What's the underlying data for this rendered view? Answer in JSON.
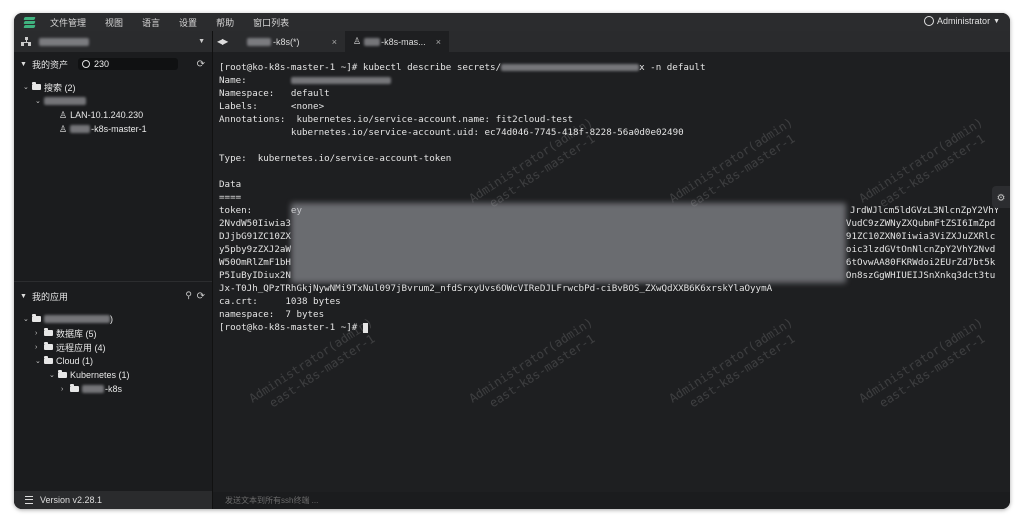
{
  "menu": {
    "items": [
      "文件管理",
      "视图",
      "语言",
      "设置",
      "帮助",
      "窗口列表"
    ],
    "user": "Administrator"
  },
  "sidebar": {
    "assets": {
      "title": "我的资产",
      "search_value": "230",
      "search_group": "搜索 (2)",
      "nodes": [
        "LAN-10.1.240.230",
        "-k8s-master-1"
      ]
    },
    "apps": {
      "title": "我的应用",
      "items": [
        "数据库 (5)",
        "远程应用 (4)",
        "Cloud (1)",
        "Kubernetes (1)",
        "-k8s"
      ]
    },
    "version": "Version v2.28.1"
  },
  "tabs": [
    {
      "label": "-k8s(*)",
      "close": "×"
    },
    {
      "label": "-k8s-mas...",
      "close": "×"
    }
  ],
  "terminal": {
    "lines": [
      {
        "a": "[root@ko-k8s-master-1 ~]# kubectl describe secrets/",
        "b": "x -n default"
      },
      {
        "a": "Name:"
      },
      {
        "a": "Namespace:   default"
      },
      {
        "a": "Labels:      <none>"
      },
      {
        "a": "Annotations:  kubernetes.io/service-account.name: fit2cloud-test"
      },
      {
        "a": "             kubernetes.io/service-account.uid: ec74d046-7745-418f-8228-56a0d0e02490"
      },
      {
        "a": ""
      },
      {
        "a": "Type:  kubernetes.io/service-account-token"
      },
      {
        "a": ""
      },
      {
        "a": "Data"
      },
      {
        "a": "===="
      },
      {
        "a": "token:       ey",
        "b": "JrdWJlcm5ldGVzL3NlcnZpY2VhY"
      },
      {
        "a": "2NvdW50Iiwia3",
        "b": "VudC9zZWNyZXQubmFtZSI6ImZpd"
      },
      {
        "a": "DJjbG91ZC10ZX",
        "b": "91ZC10ZXN0Iiwia3ViZXJuZXRlc"
      },
      {
        "a": "y5pby9zZXJ2aW",
        "b": "oic3lzdGVtOnNlcnZpY2VhY2Nvd"
      },
      {
        "a": "W50OmRlZmF1bH",
        "b": "6tOvwAA80FKRWdoi2EUrZd7bt5k"
      },
      {
        "a": "P5IuByIDiux2N",
        "b": "On8szGgWHIUEIJSnXnkq3dct3tu"
      },
      {
        "a": "Jx-T0Jh_QPzTRhGkjNywNMi9TxNul097jBvrum2_nfdSrxyUvs6OWcVIReDJLFrwcbPd-ciBvBOS_ZXwQdXXB6K6xrskYlaOyymA"
      },
      {
        "a": "ca.crt:     1038 bytes"
      },
      {
        "a": "namespace:  7 bytes"
      },
      {
        "a": "[root@ko-k8s-master-1 ~]# "
      }
    ],
    "watermark": "Administrator(admin)\n  east-k8s-master-1"
  },
  "bottom_placeholder": "发送文本到所有ssh终端 ..."
}
